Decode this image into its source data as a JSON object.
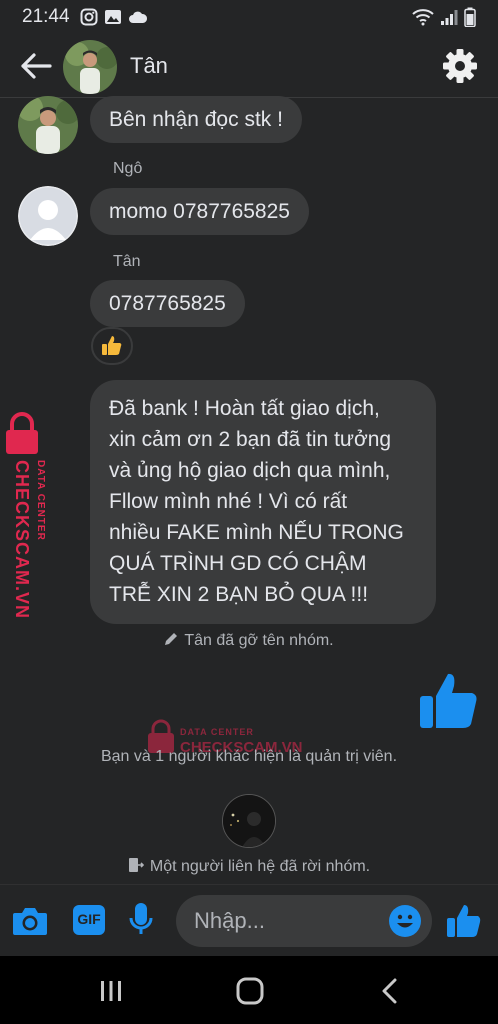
{
  "status_bar": {
    "time": "21:44"
  },
  "header": {
    "contact_name": "Tân"
  },
  "messages": [
    {
      "text": "Bên nhận đọc stk !"
    },
    {
      "sender": "Ngô",
      "text": "momo 0787765825"
    },
    {
      "sender": "Tân",
      "text": "0787765825",
      "reaction": "thumbs-up"
    },
    {
      "text_lines": [
        "Đã bank ! Hoàn tất giao dịch,",
        "xin cảm ơn 2 bạn đã tin tưởng",
        "và ủng hộ giao dịch qua mình,",
        "Fllow mình nhé ! Vì có rất",
        "nhiều FAKE mình NẾU TRONG",
        "QUÁ TRÌNH GD CÓ CHẬM",
        "TRỄ XIN 2 BẠN BỎ QUA !!!"
      ]
    }
  ],
  "system_messages": {
    "renamed": "Tân đã gỡ tên nhóm.",
    "admin": "Bạn và 1 người khác hiện là quản trị viên.",
    "left": "Một người liên hệ đã rời nhóm."
  },
  "watermark": {
    "line1": "DATA CENTER",
    "line2": "CHECKSCAM.VN",
    "color": "#e0284f"
  },
  "composer": {
    "placeholder": "Nhập...",
    "gif_label": "GIF"
  },
  "colors": {
    "accent": "#1b8fef",
    "bubble": "#3a3b3c",
    "background": "#242526"
  }
}
